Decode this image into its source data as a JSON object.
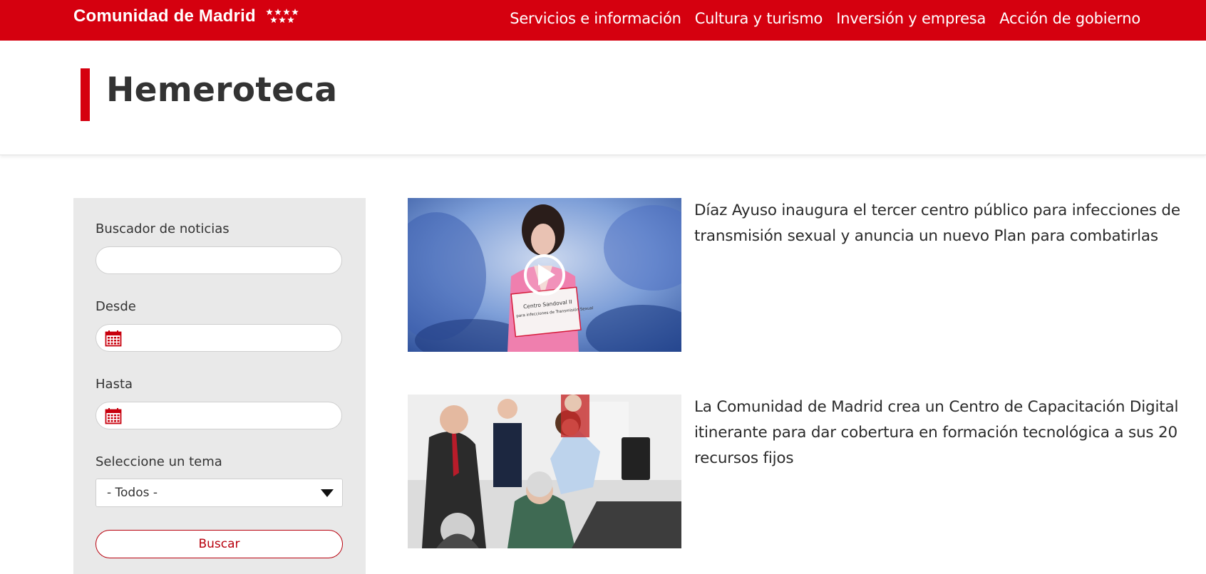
{
  "header": {
    "brand": "Comunidad de Madrid",
    "nav": [
      "Servicios e información",
      "Cultura y turismo",
      "Inversión y empresa",
      "Acción de gobierno"
    ]
  },
  "page": {
    "title": "Hemeroteca"
  },
  "filters": {
    "search_label": "Buscador de noticias",
    "search_value": "",
    "from_label": "Desde",
    "from_value": "",
    "to_label": "Hasta",
    "to_value": "",
    "topic_label": "Seleccione un tema",
    "topic_selected": "- Todos -",
    "search_button": "Buscar"
  },
  "news": [
    {
      "title": "Díaz Ayuso inaugura el tercer centro público para infecciones de transmisión sexual y anuncia un nuevo Plan para combatirlas",
      "has_video": true,
      "podium_sign_line1": "Centro Sandoval II",
      "podium_sign_line2": "para infecciones de Transmisión Sexual"
    },
    {
      "title": "La Comunidad de Madrid crea un Centro de Capacitación Digital itinerante para dar cobertura en formación tecnológica a sus 20 recursos fijos",
      "has_video": false
    }
  ],
  "colors": {
    "brand_red": "#d5000f",
    "button_red": "#b8000d",
    "panel_gray": "#e9e9e9"
  }
}
